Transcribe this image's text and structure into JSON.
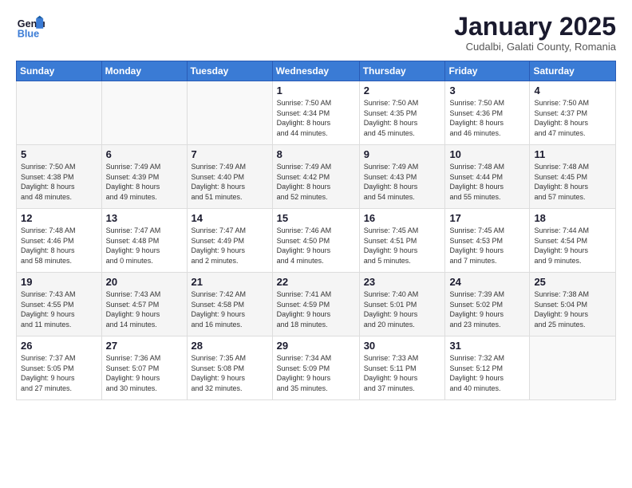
{
  "header": {
    "logo_line1": "General",
    "logo_line2": "Blue",
    "month_title": "January 2025",
    "subtitle": "Cudalbi, Galati County, Romania"
  },
  "days_of_week": [
    "Sunday",
    "Monday",
    "Tuesday",
    "Wednesday",
    "Thursday",
    "Friday",
    "Saturday"
  ],
  "weeks": [
    [
      {
        "num": "",
        "info": ""
      },
      {
        "num": "",
        "info": ""
      },
      {
        "num": "",
        "info": ""
      },
      {
        "num": "1",
        "info": "Sunrise: 7:50 AM\nSunset: 4:34 PM\nDaylight: 8 hours\nand 44 minutes."
      },
      {
        "num": "2",
        "info": "Sunrise: 7:50 AM\nSunset: 4:35 PM\nDaylight: 8 hours\nand 45 minutes."
      },
      {
        "num": "3",
        "info": "Sunrise: 7:50 AM\nSunset: 4:36 PM\nDaylight: 8 hours\nand 46 minutes."
      },
      {
        "num": "4",
        "info": "Sunrise: 7:50 AM\nSunset: 4:37 PM\nDaylight: 8 hours\nand 47 minutes."
      }
    ],
    [
      {
        "num": "5",
        "info": "Sunrise: 7:50 AM\nSunset: 4:38 PM\nDaylight: 8 hours\nand 48 minutes."
      },
      {
        "num": "6",
        "info": "Sunrise: 7:49 AM\nSunset: 4:39 PM\nDaylight: 8 hours\nand 49 minutes."
      },
      {
        "num": "7",
        "info": "Sunrise: 7:49 AM\nSunset: 4:40 PM\nDaylight: 8 hours\nand 51 minutes."
      },
      {
        "num": "8",
        "info": "Sunrise: 7:49 AM\nSunset: 4:42 PM\nDaylight: 8 hours\nand 52 minutes."
      },
      {
        "num": "9",
        "info": "Sunrise: 7:49 AM\nSunset: 4:43 PM\nDaylight: 8 hours\nand 54 minutes."
      },
      {
        "num": "10",
        "info": "Sunrise: 7:48 AM\nSunset: 4:44 PM\nDaylight: 8 hours\nand 55 minutes."
      },
      {
        "num": "11",
        "info": "Sunrise: 7:48 AM\nSunset: 4:45 PM\nDaylight: 8 hours\nand 57 minutes."
      }
    ],
    [
      {
        "num": "12",
        "info": "Sunrise: 7:48 AM\nSunset: 4:46 PM\nDaylight: 8 hours\nand 58 minutes."
      },
      {
        "num": "13",
        "info": "Sunrise: 7:47 AM\nSunset: 4:48 PM\nDaylight: 9 hours\nand 0 minutes."
      },
      {
        "num": "14",
        "info": "Sunrise: 7:47 AM\nSunset: 4:49 PM\nDaylight: 9 hours\nand 2 minutes."
      },
      {
        "num": "15",
        "info": "Sunrise: 7:46 AM\nSunset: 4:50 PM\nDaylight: 9 hours\nand 4 minutes."
      },
      {
        "num": "16",
        "info": "Sunrise: 7:45 AM\nSunset: 4:51 PM\nDaylight: 9 hours\nand 5 minutes."
      },
      {
        "num": "17",
        "info": "Sunrise: 7:45 AM\nSunset: 4:53 PM\nDaylight: 9 hours\nand 7 minutes."
      },
      {
        "num": "18",
        "info": "Sunrise: 7:44 AM\nSunset: 4:54 PM\nDaylight: 9 hours\nand 9 minutes."
      }
    ],
    [
      {
        "num": "19",
        "info": "Sunrise: 7:43 AM\nSunset: 4:55 PM\nDaylight: 9 hours\nand 11 minutes."
      },
      {
        "num": "20",
        "info": "Sunrise: 7:43 AM\nSunset: 4:57 PM\nDaylight: 9 hours\nand 14 minutes."
      },
      {
        "num": "21",
        "info": "Sunrise: 7:42 AM\nSunset: 4:58 PM\nDaylight: 9 hours\nand 16 minutes."
      },
      {
        "num": "22",
        "info": "Sunrise: 7:41 AM\nSunset: 4:59 PM\nDaylight: 9 hours\nand 18 minutes."
      },
      {
        "num": "23",
        "info": "Sunrise: 7:40 AM\nSunset: 5:01 PM\nDaylight: 9 hours\nand 20 minutes."
      },
      {
        "num": "24",
        "info": "Sunrise: 7:39 AM\nSunset: 5:02 PM\nDaylight: 9 hours\nand 23 minutes."
      },
      {
        "num": "25",
        "info": "Sunrise: 7:38 AM\nSunset: 5:04 PM\nDaylight: 9 hours\nand 25 minutes."
      }
    ],
    [
      {
        "num": "26",
        "info": "Sunrise: 7:37 AM\nSunset: 5:05 PM\nDaylight: 9 hours\nand 27 minutes."
      },
      {
        "num": "27",
        "info": "Sunrise: 7:36 AM\nSunset: 5:07 PM\nDaylight: 9 hours\nand 30 minutes."
      },
      {
        "num": "28",
        "info": "Sunrise: 7:35 AM\nSunset: 5:08 PM\nDaylight: 9 hours\nand 32 minutes."
      },
      {
        "num": "29",
        "info": "Sunrise: 7:34 AM\nSunset: 5:09 PM\nDaylight: 9 hours\nand 35 minutes."
      },
      {
        "num": "30",
        "info": "Sunrise: 7:33 AM\nSunset: 5:11 PM\nDaylight: 9 hours\nand 37 minutes."
      },
      {
        "num": "31",
        "info": "Sunrise: 7:32 AM\nSunset: 5:12 PM\nDaylight: 9 hours\nand 40 minutes."
      },
      {
        "num": "",
        "info": ""
      }
    ]
  ]
}
